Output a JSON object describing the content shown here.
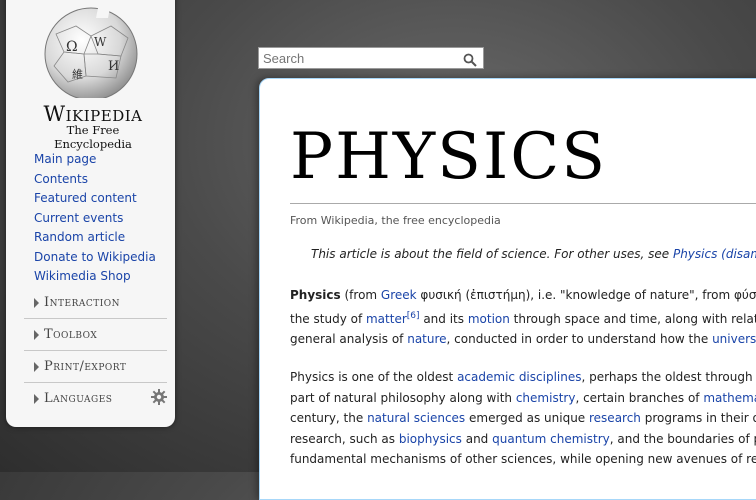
{
  "sidebar": {
    "logo": {
      "name": "Wikipedia",
      "tagline": "The Free Encyclopedia"
    },
    "nav": [
      "Main page",
      "Contents",
      "Featured content",
      "Current events",
      "Random article",
      "Donate to Wikipedia",
      "Wikimedia Shop"
    ],
    "portlets": [
      "Interaction",
      "Toolbox",
      "Print/export",
      "Languages"
    ]
  },
  "search": {
    "placeholder": "Search"
  },
  "article": {
    "title": "PHYSICS",
    "from": "From Wikipedia, the free encyclopedia",
    "hatnote": {
      "text": "This article is about the field of science. For other uses, see",
      "link": "Physics (disambiguation)"
    },
    "p1": {
      "l1a": "Physics",
      "l1b": " (from ",
      "l1c": "Greek",
      "l1d": " φυσική (ἐπιστήμη), i.e. \"knowledge of nature\", from φύσις, ",
      "l2a": "the study of ",
      "l2b": "matter",
      "l2c": "[6]",
      "l2d": " and its ",
      "l2e": "motion",
      "l2f": " through space and time, along with related",
      "l3a": "general analysis of ",
      "l3b": "nature",
      "l3c": ", conducted in order to understand how the ",
      "l3d": "universe"
    },
    "p2": {
      "l1a": "Physics is one of the oldest ",
      "l1b": "academic disciplines",
      "l1c": ", perhaps the oldest through its",
      "l2a": "part of natural philosophy along with ",
      "l2b": "chemistry",
      "l2c": ", certain branches of ",
      "l2d": "mathematics",
      "l3a": "century, the ",
      "l3b": "natural sciences",
      "l3c": " emerged as unique ",
      "l3d": "research",
      "l3e": " programs in their own",
      "l4a": "research, such as ",
      "l4b": "biophysics",
      "l4c": " and ",
      "l4d": "quantum chemistry",
      "l4e": ", and the boundaries of physics",
      "l5a": "fundamental mechanisms of other sciences, while opening new avenues of research"
    }
  }
}
